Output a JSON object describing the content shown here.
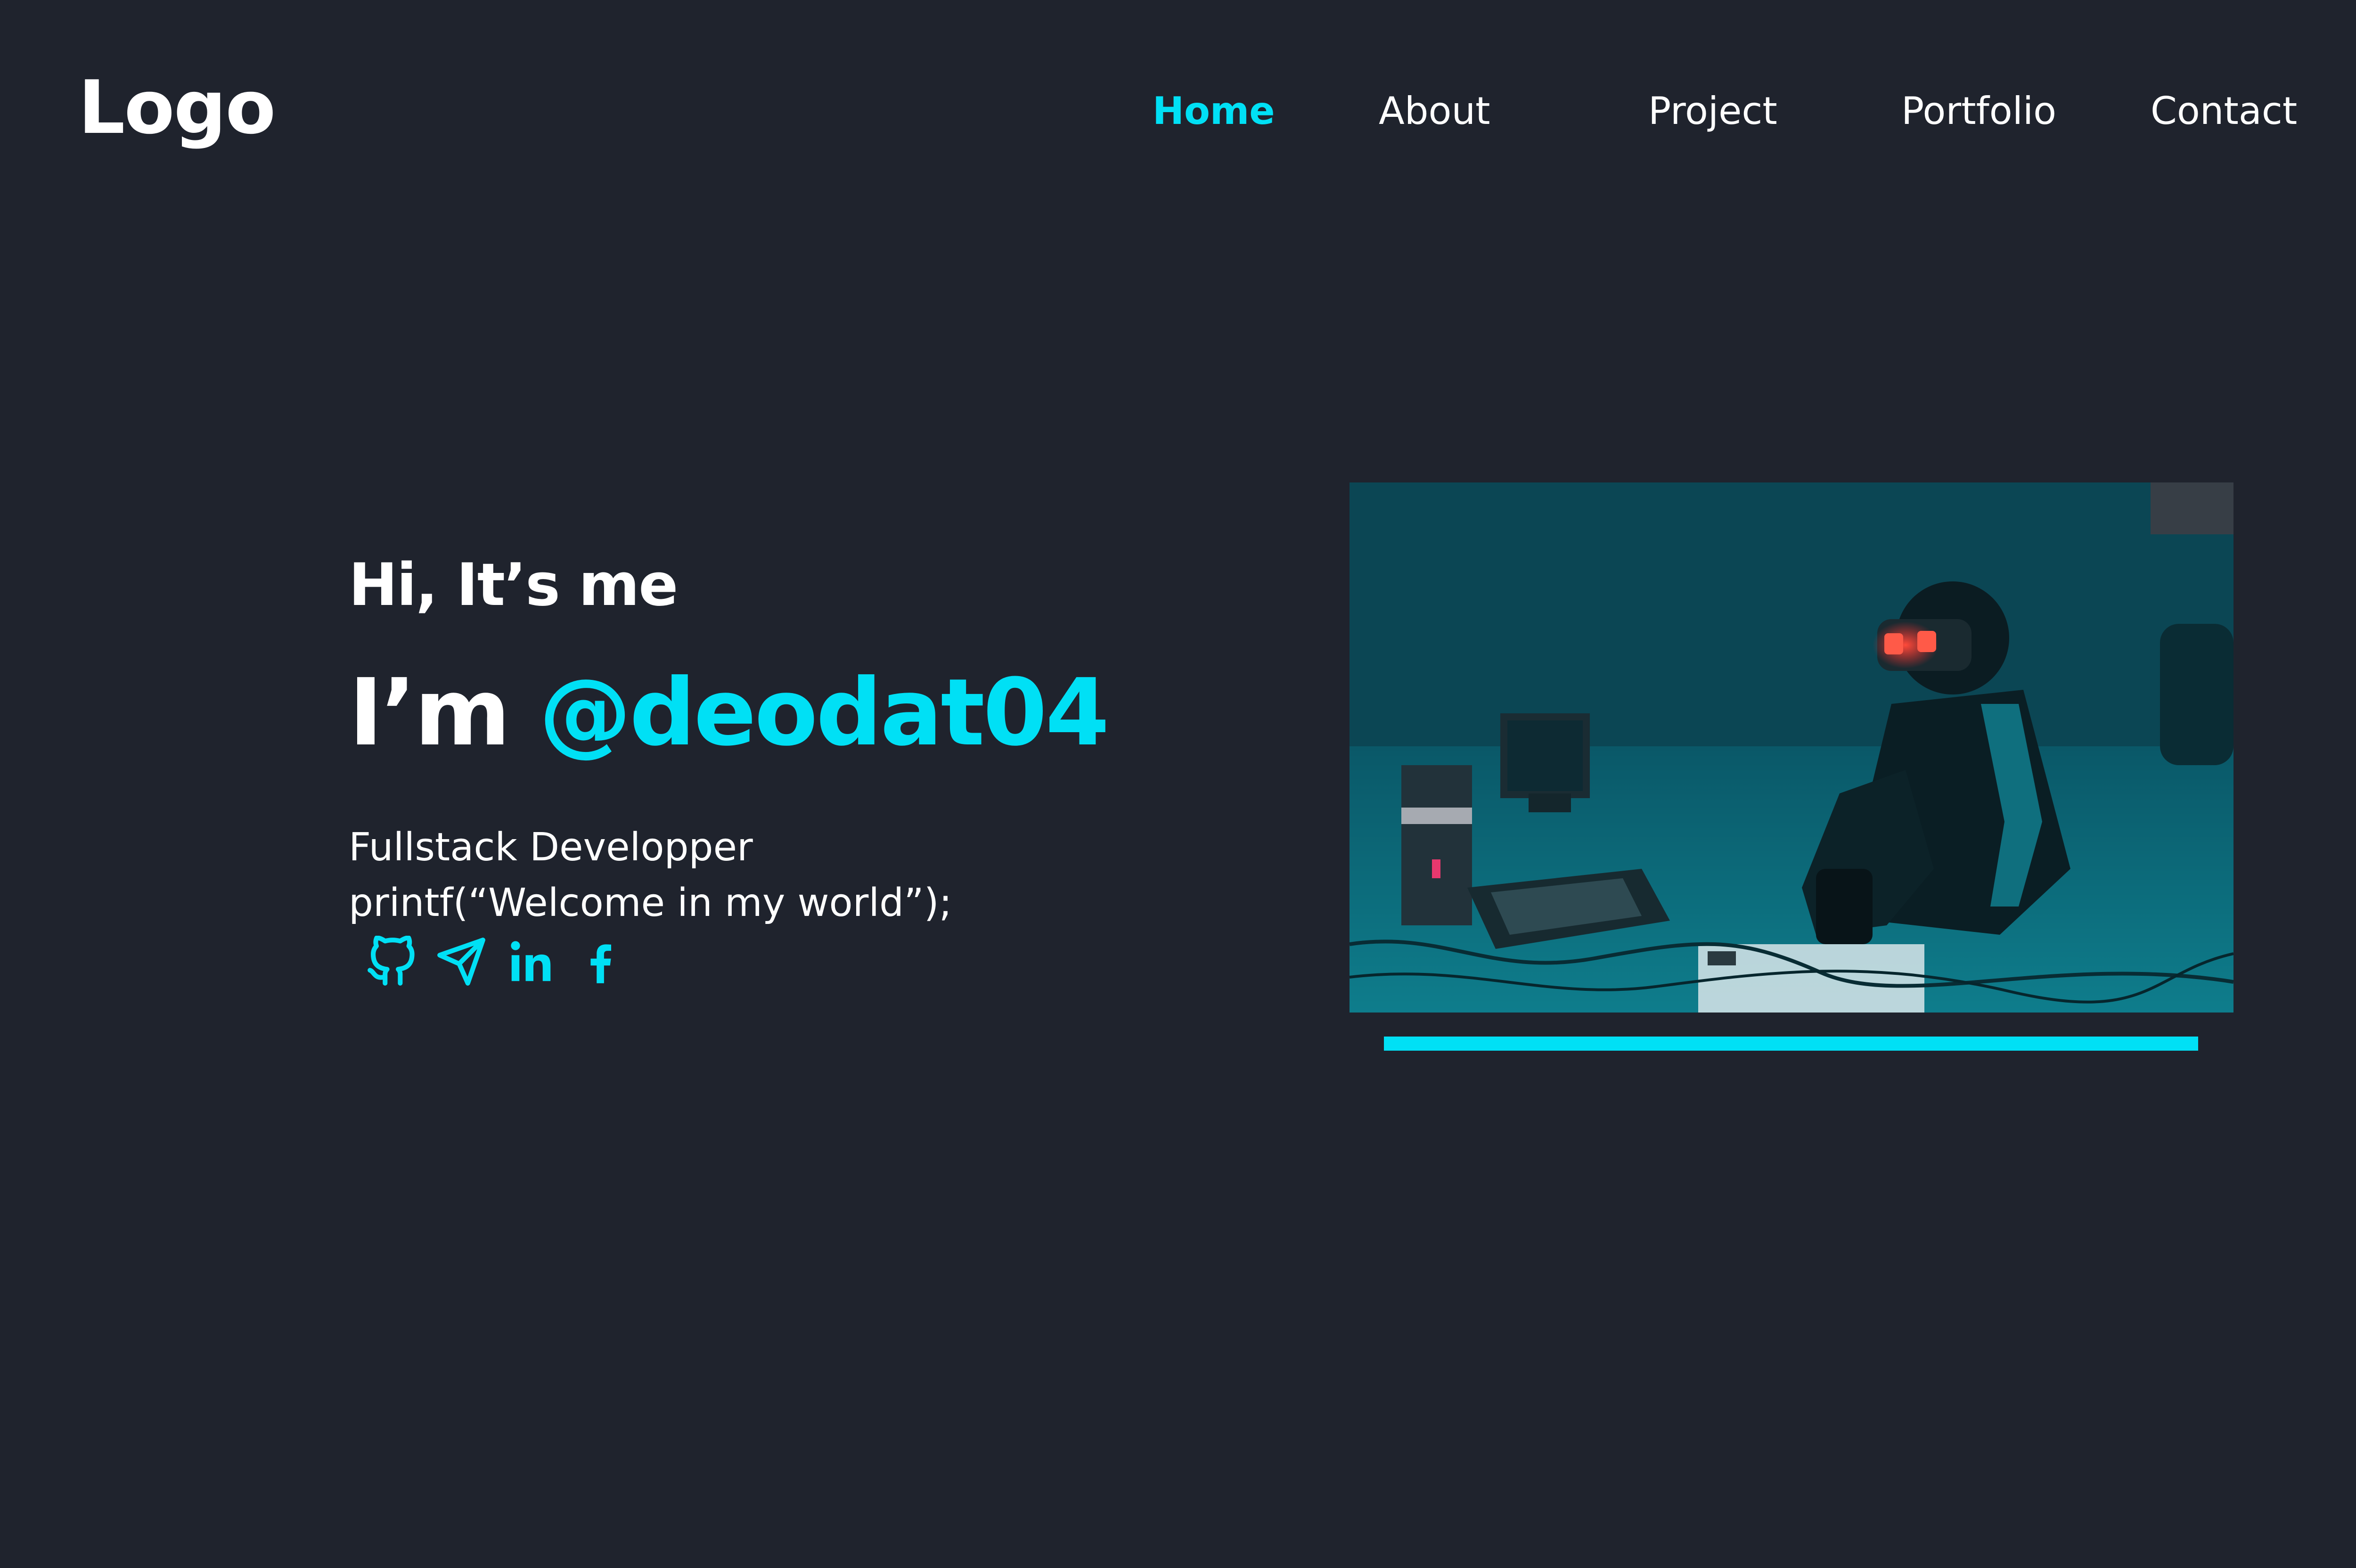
{
  "header": {
    "logo": "Logo",
    "nav": [
      {
        "label": "Home",
        "active": true
      },
      {
        "label": "About",
        "active": false
      },
      {
        "label": "Project",
        "active": false
      },
      {
        "label": "Portfolio",
        "active": false
      },
      {
        "label": "Contact",
        "active": false
      }
    ]
  },
  "hero": {
    "greeting": "Hi, It’s me",
    "headline_prefix": "I’m",
    "headline_handle": "@deodat04",
    "role": "Fullstack Developper",
    "code_line": "printf(“Welcome in my world”);",
    "socials": [
      "github-icon",
      "send-icon",
      "linkedin-icon",
      "facebook-icon"
    ],
    "image_subject": "person-with-vr-headset"
  },
  "colors": {
    "background": "#1f232d",
    "accent": "#00e0f5",
    "text": "#ffffff"
  }
}
